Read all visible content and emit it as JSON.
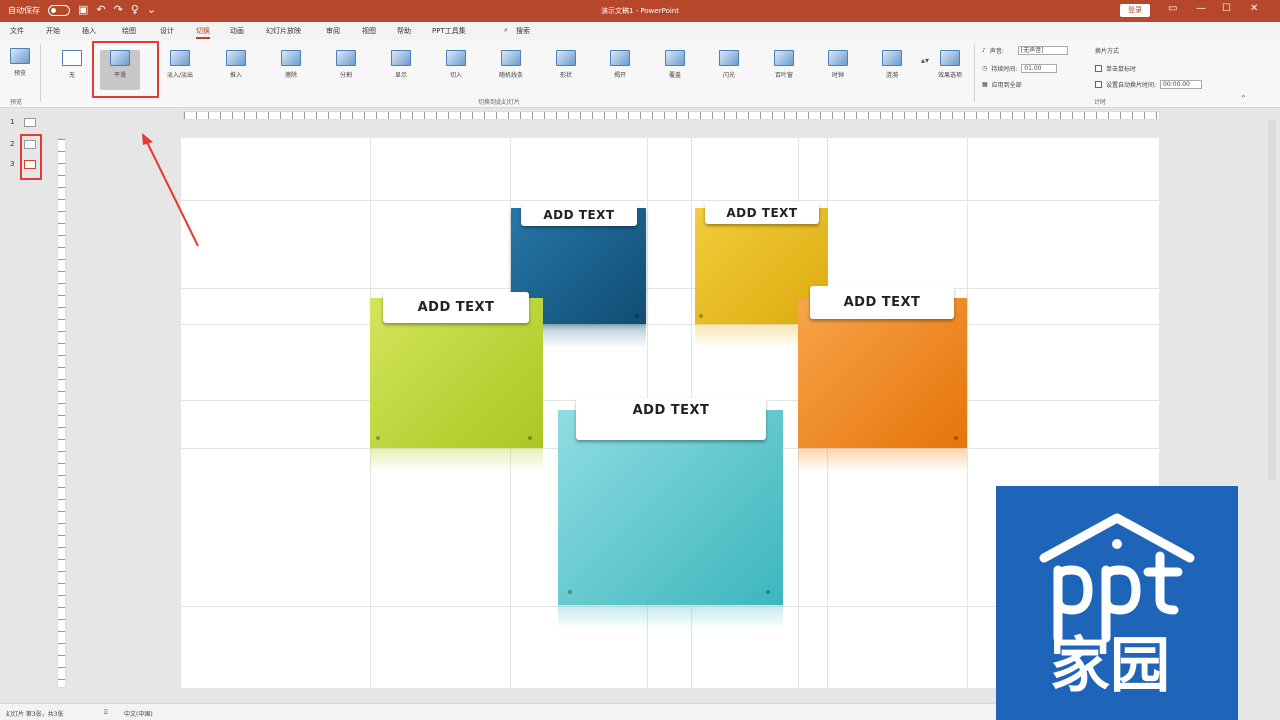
{
  "titlebar": {
    "autosave_label": "自动保存",
    "doc_title": "演示文稿1 - PowerPoint",
    "signin_label": "登录",
    "icons": [
      "save-icon",
      "undo-icon",
      "redo-icon",
      "presenter-icon"
    ]
  },
  "menu": {
    "tabs": [
      "文件",
      "开始",
      "插入",
      "绘图",
      "设计",
      "切换",
      "动画",
      "幻灯片放映",
      "审阅",
      "视图",
      "帮助",
      "PPT工具集",
      "搜索"
    ],
    "active_index": 5
  },
  "ribbon": {
    "preview_label": "预览",
    "preview_group": "预览",
    "effects": [
      "无",
      "平滑",
      "淡入/淡出",
      "推入",
      "擦除",
      "分割",
      "显示",
      "切入",
      "随机线条",
      "形状",
      "揭开",
      "覆盖",
      "闪光",
      "百叶窗",
      "时钟",
      "涟漪"
    ],
    "selected_effect_index": 1,
    "effect_options_label": "效果选项",
    "group_transition": "切换到此幻灯片",
    "timing": {
      "sound_label": "声音:",
      "sound_value": "[无声音]",
      "duration_label": "持续时间:",
      "duration_value": "01.00",
      "apply_all_label": "应用到全部",
      "advance_label": "换片方式",
      "on_click_label": "单击鼠标时",
      "after_label": "设置自动换片时间:",
      "after_value": "00:00.00",
      "group_label": "计时"
    }
  },
  "thumbnails": [
    "1",
    "2",
    "3"
  ],
  "slide": {
    "cards": [
      {
        "label": "ADD TEXT",
        "color": "#1b5e88"
      },
      {
        "label": "ADD TEXT",
        "color": "#e5b91a"
      },
      {
        "label": "ADD TEXT",
        "color": "#b7d334"
      },
      {
        "label": "ADD TEXT",
        "color": "#ee8214"
      },
      {
        "label": "ADD TEXT",
        "color": "#4fc0c6"
      }
    ]
  },
  "logo": {
    "brand_text": "ppt家园",
    "color": "#1e64b9"
  },
  "status": {
    "slide_info": "幻灯片 第3张，共3张",
    "language": "中文(中国)"
  }
}
